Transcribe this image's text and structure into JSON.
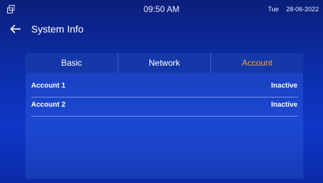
{
  "status_bar": {
    "time": "09:50 AM",
    "day": "Tue",
    "date": "28-06-2022",
    "left_icon": "window-restore-icon"
  },
  "header": {
    "title": "System Info",
    "back_icon": "arrow-left-icon"
  },
  "tabs": [
    {
      "label": "Basic",
      "active": false
    },
    {
      "label": "Network",
      "active": false
    },
    {
      "label": "Account",
      "active": true
    }
  ],
  "accounts": [
    {
      "name": "Account 1",
      "status": "Inactive"
    },
    {
      "name": "Account 2",
      "status": "Inactive"
    }
  ],
  "colors": {
    "active_tab": "#f0a040",
    "background": "#0e36c8"
  }
}
